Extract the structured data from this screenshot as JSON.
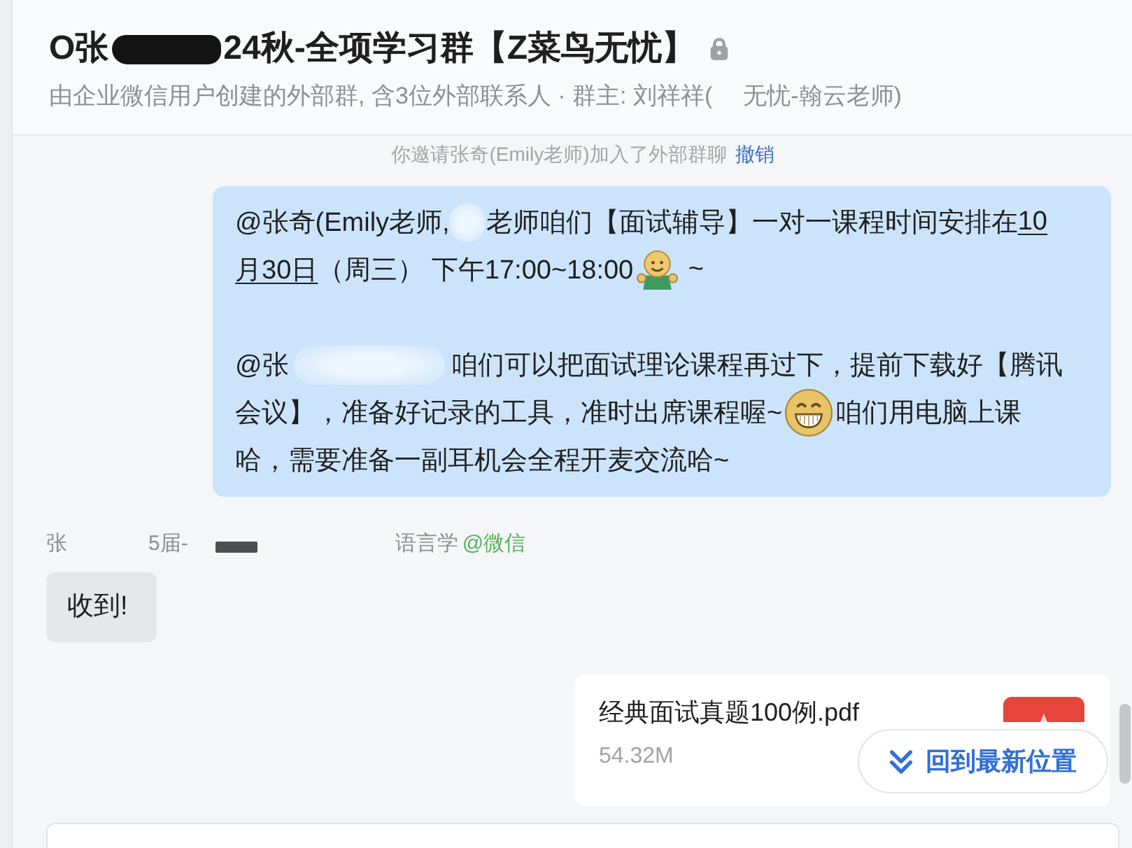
{
  "header": {
    "title": [
      {
        "kind": "text",
        "text": "O张"
      },
      {
        "kind": "blot"
      },
      {
        "kind": "text",
        "text": "24秋-全项学习群【Z菜鸟无忧】"
      }
    ],
    "subtitle": [
      {
        "kind": "text",
        "text": "由企业微信用户创建的外部群, 含3位外部联系人 · 群主: 刘祥祥("
      },
      {
        "kind": "blank"
      },
      {
        "kind": "text",
        "text": "无忧-翰云老师)"
      }
    ]
  },
  "messages": [
    {
      "kind": "notice",
      "text": "你邀请张奇(Emily老师)加入了外部群聊",
      "action": "撤销"
    },
    {
      "kind": "sent",
      "paragraphs": [
        {
          "lines": [
            [
              {
                "kind": "text",
                "text": "@张奇(Emily老师,"
              },
              {
                "kind": "smudge"
              },
              {
                "kind": "text",
                "text": "老师咱们【面试辅导】一对一课程时间安排在"
              },
              {
                "kind": "link",
                "text": "10"
              }
            ],
            [
              {
                "kind": "link",
                "text": "月30日"
              },
              {
                "kind": "text",
                "text": "（周三） 下午17:00~18:00"
              },
              {
                "kind": "hug"
              },
              {
                "kind": "text",
                "text": " ~"
              }
            ]
          ]
        },
        {
          "lines": [
            [
              {
                "kind": "text",
                "text": "@张"
              },
              {
                "kind": "smudge"
              },
              {
                "kind": "text",
                "text": "咱们可以把面试理论课程再过下，提前下载好【腾讯"
              }
            ],
            [
              {
                "kind": "text",
                "text": "会议】，准备好记录的工具，准时出席课程喔~"
              },
              {
                "kind": "grin"
              },
              {
                "kind": "text",
                "text": "咱们用电脑上课"
              }
            ],
            [
              {
                "kind": "text",
                "text": "哈，需要准备一副耳机会全程开麦交流哈~"
              }
            ]
          ]
        }
      ]
    },
    {
      "kind": "received",
      "sender": [
        {
          "kind": "text",
          "text": "张"
        },
        {
          "kind": "blank"
        },
        {
          "kind": "text",
          "text": "5届-"
        },
        {
          "kind": "blot"
        },
        {
          "kind": "blank"
        },
        {
          "kind": "text",
          "text": "语言学"
        }
      ],
      "source": "@微信",
      "text": "收到!"
    },
    {
      "kind": "file",
      "name": "经典面试真题100例.pdf",
      "size": "54.32M"
    }
  ],
  "jump_button": {
    "label": "回到最新位置"
  }
}
